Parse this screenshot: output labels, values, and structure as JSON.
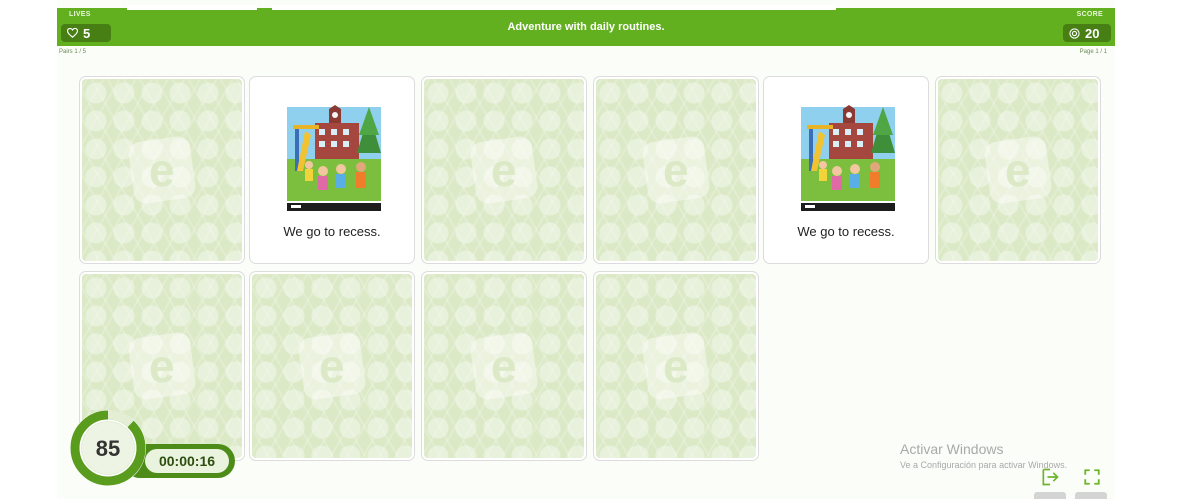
{
  "header": {
    "lives_label": "LIVES",
    "lives_value": "5",
    "title": "Adventure with daily routines.",
    "score_label": "SCORE",
    "score_value": "20",
    "pairs_text": "Pairs 1 / 5",
    "page_text": "Page 1 / 1"
  },
  "cards": [
    {
      "state": "hidden"
    },
    {
      "state": "revealed",
      "caption": "We go to recess."
    },
    {
      "state": "hidden"
    },
    {
      "state": "hidden"
    },
    {
      "state": "revealed",
      "caption": "We go to recess."
    },
    {
      "state": "hidden"
    },
    {
      "state": "hidden"
    },
    {
      "state": "hidden"
    },
    {
      "state": "hidden"
    },
    {
      "state": "hidden"
    }
  ],
  "card_logo_letter": "e",
  "timer": {
    "score": "85",
    "elapsed": "00:00:16",
    "progress": 0.12
  },
  "watermark": {
    "title": "Activar Windows",
    "subtitle": "Ve a Configuración para activar Windows."
  },
  "colors": {
    "accent": "#62b01f",
    "accent_dark": "#477f14",
    "card_back": "#dce9c7"
  },
  "icons": {
    "lives": "heart-icon",
    "score": "coin-icon",
    "exit": "exit-icon",
    "fullscreen": "fullscreen-icon"
  }
}
